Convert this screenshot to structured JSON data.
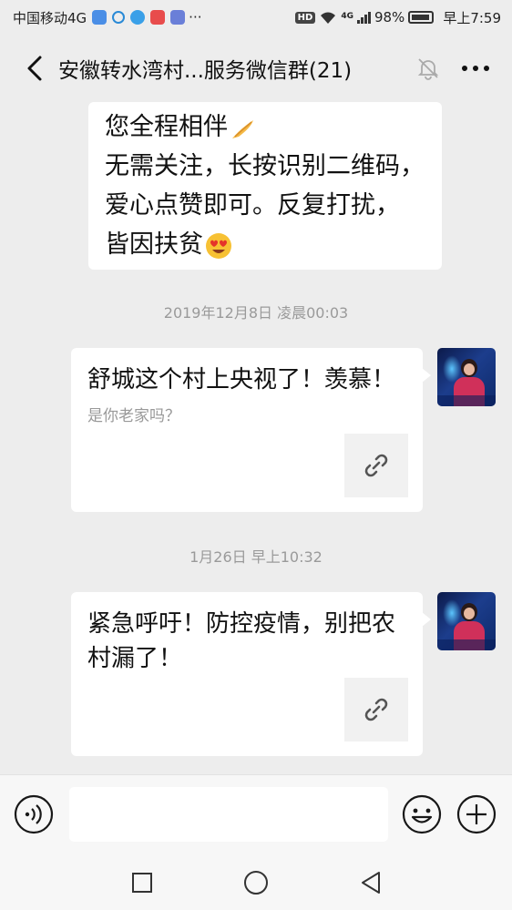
{
  "status_bar": {
    "carrier": "中国移动4G",
    "network": "4G",
    "battery": "98%",
    "time": "早上7:59",
    "hd_label": "HD",
    "more": "···"
  },
  "header": {
    "title": "安徽转水湾村...服务微信群(21)"
  },
  "messages": [
    {
      "type": "text",
      "lines": [
        "您全程相伴",
        "无需关注，长按识别二维码，",
        "爱心点赞即可。反复打扰，",
        "皆因扶贫"
      ],
      "emojis": [
        "ok-hand-emoji",
        "heart-eyes-emoji"
      ]
    },
    {
      "type": "timestamp",
      "text": "2019年12月8日 凌晨00:03"
    },
    {
      "type": "link",
      "title": "舒城这个村上央视了！羡慕！",
      "description": "是你老家吗？",
      "thumb_icon": "link-icon"
    },
    {
      "type": "timestamp",
      "text": "1月26日 早上10:32"
    },
    {
      "type": "link",
      "title": "紧急呼吁！防控疫情，别把农村漏了！",
      "description": "",
      "thumb_icon": "link-icon"
    }
  ],
  "input_bar": {
    "placeholder": "",
    "icons": [
      "voice-icon",
      "emoji-icon",
      "plus-icon"
    ]
  },
  "system_nav": {
    "icons": [
      "square-recents-icon",
      "circle-home-icon",
      "triangle-back-icon"
    ]
  },
  "colors": {
    "background": "#ededed",
    "bubble": "#ffffff",
    "timestamp": "#9a9a9a",
    "link_thumb_bg": "#f1f1f1"
  }
}
